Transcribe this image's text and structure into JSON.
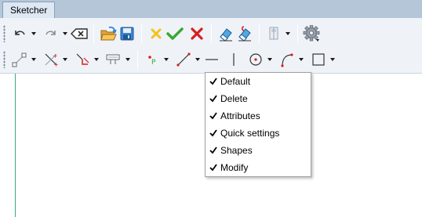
{
  "window": {
    "tab_label": "Sketcher"
  },
  "colors": {
    "tabstrip_bg": "#b5c6d9",
    "toolbar_bg": "#eff3f8",
    "axis_green": "#3aa882",
    "red": "#d81e1e",
    "green_check": "#3aa834",
    "yellow": "#f2c21b"
  },
  "toolbar_row1": {
    "icons": [
      "undo-icon",
      "redo-icon",
      "clear-icon",
      "open-folder-icon",
      "save-icon",
      "cancel-yellow-icon",
      "accept-check-icon",
      "close-red-icon",
      "eraser-icon",
      "attribute-eraser-icon",
      "properties-icon",
      "settings-gear-icon"
    ]
  },
  "toolbar_row2": {
    "icons": [
      "modify-segment-icon",
      "trim-icon",
      "fillet-icon",
      "offset-icon",
      "point-icon",
      "line-icon",
      "horizontal-line-icon",
      "vertical-line-icon",
      "circle-icon",
      "arc-icon",
      "rectangle-icon"
    ]
  },
  "context_menu": {
    "items": [
      {
        "label": "Default",
        "checked": true
      },
      {
        "label": "Delete",
        "checked": true
      },
      {
        "label": "Attributes",
        "checked": true
      },
      {
        "label": "Quick settings",
        "checked": true
      },
      {
        "label": "Shapes",
        "checked": true
      },
      {
        "label": "Modify",
        "checked": true
      }
    ]
  }
}
